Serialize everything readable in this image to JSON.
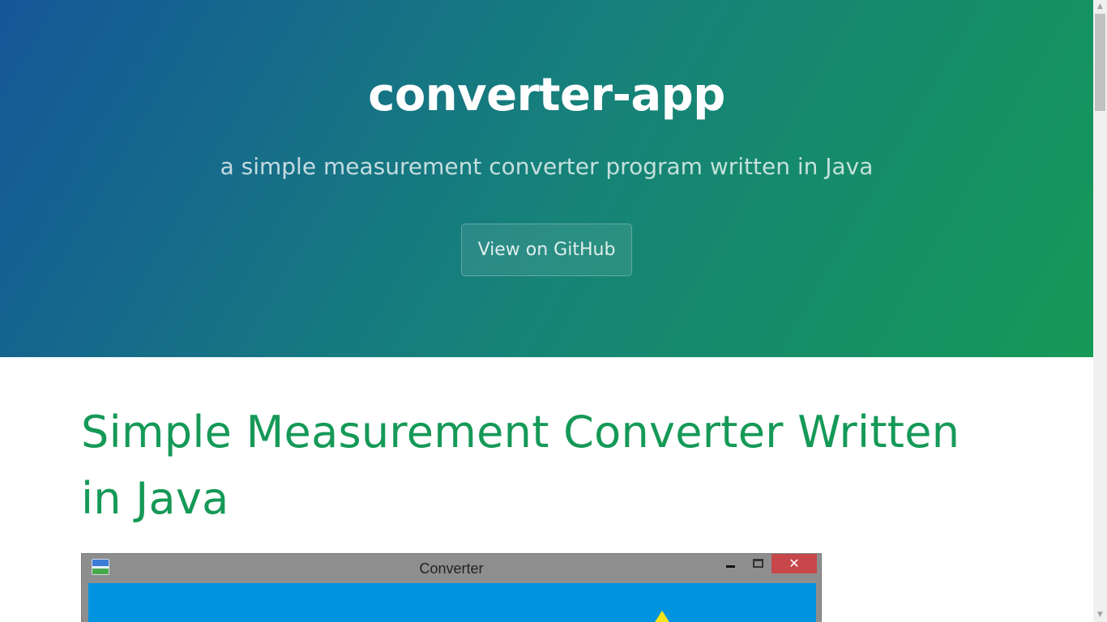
{
  "hero": {
    "title": "converter-app",
    "tagline": "a simple measurement converter program written in Java",
    "github_button": "View on GitHub",
    "gradient_colors": [
      "#155799",
      "#159957"
    ]
  },
  "main": {
    "heading": "Simple Measurement Converter Written in Java",
    "heading_color": "#159957"
  },
  "screenshot": {
    "window_title": "Converter",
    "close_glyph": "✕",
    "app_icon": "converter-app-icon",
    "body_color": "#0094e0"
  },
  "scrollbar": {
    "up_glyph": "▲",
    "down_glyph": "▼"
  }
}
